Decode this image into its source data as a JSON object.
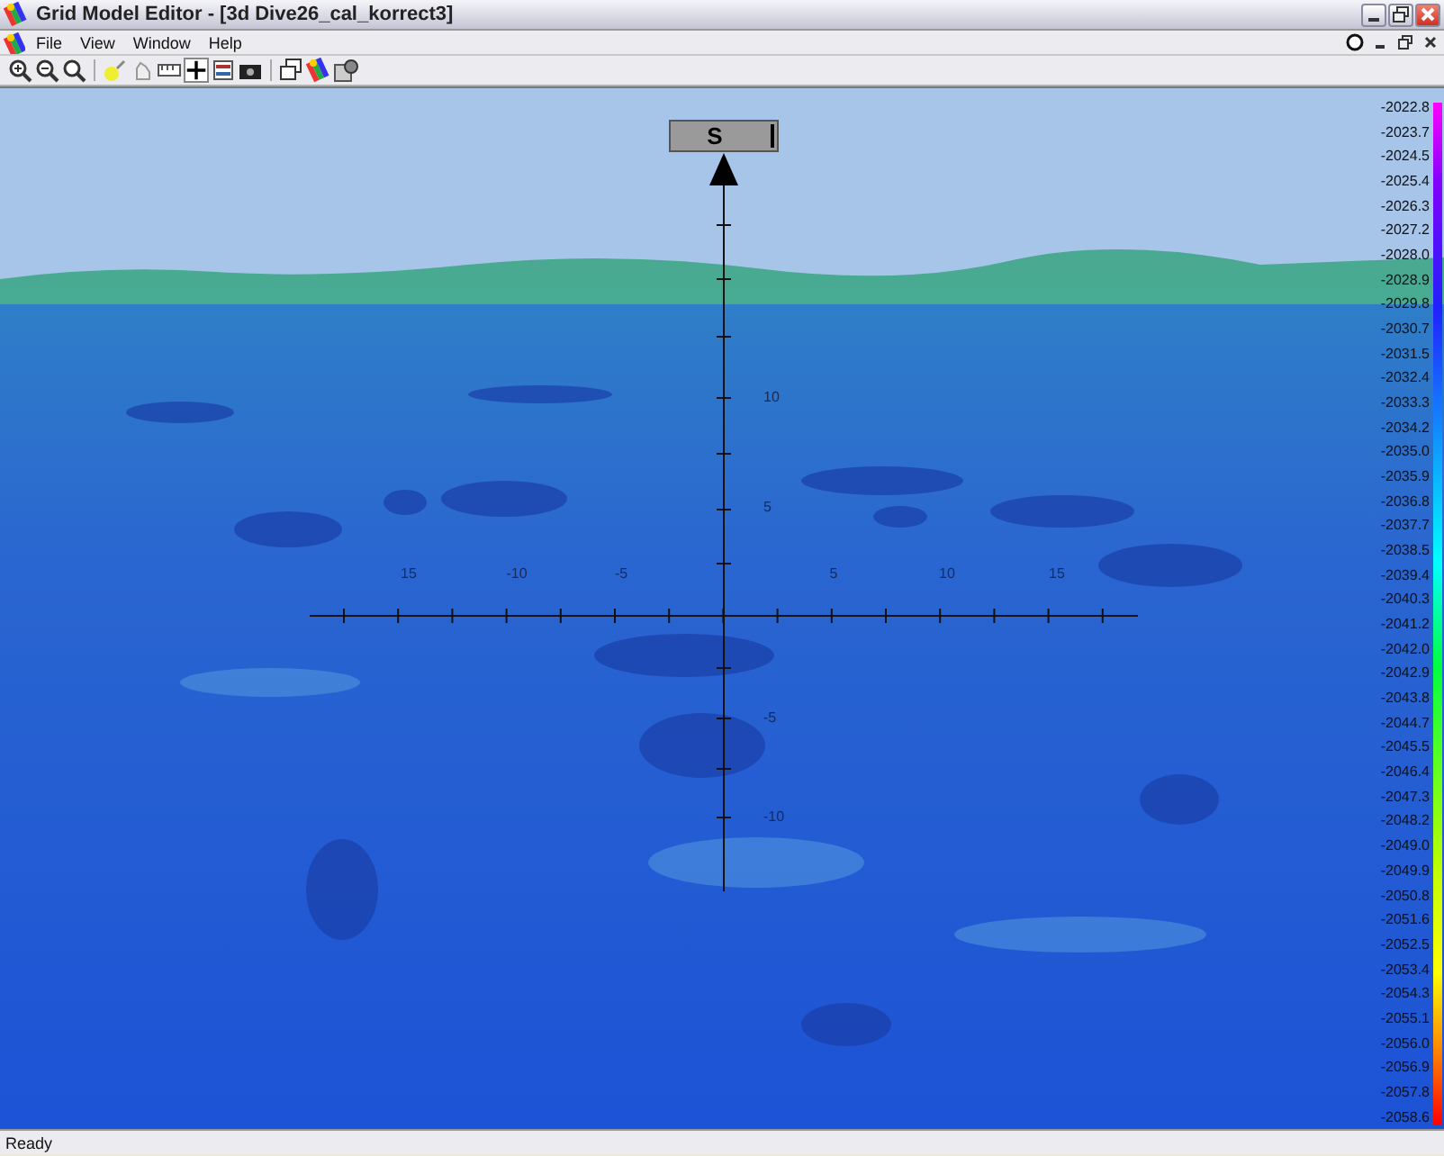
{
  "window": {
    "title": "Grid Model Editor - [3d Dive26_cal_korrect3]"
  },
  "menu": [
    "File",
    "View",
    "Window",
    "Help"
  ],
  "view": {
    "compass_label": "S",
    "x_axis_labels": [
      "15",
      "-10",
      "-5",
      "5",
      "10",
      "15"
    ],
    "y_axis_labels": [
      "10",
      "5",
      "-5",
      "-10"
    ],
    "color_scale": [
      "-2022.8",
      "-2023.7",
      "-2024.5",
      "-2025.4",
      "-2026.3",
      "-2027.2",
      "-2028.0",
      "-2028.9",
      "-2029.8",
      "-2030.7",
      "-2031.5",
      "-2032.4",
      "-2033.3",
      "-2034.2",
      "-2035.0",
      "-2035.9",
      "-2036.8",
      "-2037.7",
      "-2038.5",
      "-2039.4",
      "-2040.3",
      "-2041.2",
      "-2042.0",
      "-2042.9",
      "-2043.8",
      "-2044.7",
      "-2045.5",
      "-2046.4",
      "-2047.3",
      "-2048.2",
      "-2049.0",
      "-2049.9",
      "-2050.8",
      "-2051.6",
      "-2052.5",
      "-2053.4",
      "-2054.3",
      "-2055.1",
      "-2056.0",
      "-2056.9",
      "-2057.8",
      "-2058.6"
    ]
  },
  "status_bar": {
    "text": "Ready"
  }
}
